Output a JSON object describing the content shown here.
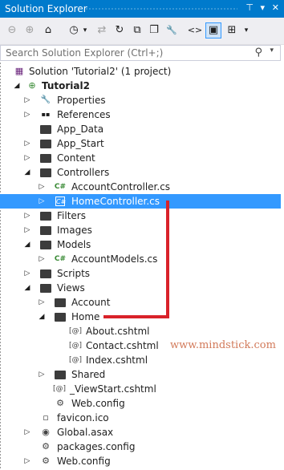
{
  "titlebar": {
    "title": "Solution Explorer",
    "pin_glyph": "⊤",
    "close_glyph": "✕"
  },
  "toolbar": {
    "buttons": [
      {
        "icon": "back-icon",
        "glyph": "⊖"
      },
      {
        "icon": "forward-icon",
        "glyph": "⊕"
      },
      {
        "icon": "home-icon",
        "glyph": "⌂"
      },
      {
        "icon": "history-icon",
        "glyph": "◷"
      },
      {
        "icon": "sync-icon",
        "glyph": "⇄"
      },
      {
        "icon": "refresh-icon",
        "glyph": "↻"
      },
      {
        "icon": "collapse-all-icon",
        "glyph": "⧉"
      },
      {
        "icon": "show-all-files-icon",
        "glyph": "❐"
      },
      {
        "icon": "properties-icon",
        "glyph": "🔧"
      },
      {
        "icon": "view-code-icon",
        "glyph": "<>"
      },
      {
        "icon": "preview-icon",
        "glyph": "▣"
      },
      {
        "icon": "class-view-icon",
        "glyph": "⊞"
      },
      {
        "icon": "dropdown-icon",
        "glyph": "▾"
      }
    ]
  },
  "search": {
    "placeholder": "Search Solution Explorer (Ctrl+;)",
    "icon_glyph": "⚲",
    "dropdown_glyph": "▾"
  },
  "tree": {
    "items": [
      {
        "label": "Solution 'Tutorial2' (1 project)",
        "icon": "solution-icon",
        "glyph": "▦",
        "arrow": ""
      },
      {
        "label": "Tutorial2",
        "icon": "project-icon",
        "glyph": "⊕",
        "arrow": "◢",
        "bold": true
      },
      {
        "label": "Properties",
        "icon": "wrench-icon",
        "glyph": "🔧",
        "arrow": "▷"
      },
      {
        "label": "References",
        "icon": "references-icon",
        "glyph": "▪▪",
        "arrow": "▷"
      },
      {
        "label": "App_Data",
        "icon": "folder-icon",
        "glyph": "",
        "arrow": ""
      },
      {
        "label": "App_Start",
        "icon": "folder-icon",
        "glyph": "",
        "arrow": "▷"
      },
      {
        "label": "Content",
        "icon": "folder-icon",
        "glyph": "",
        "arrow": "▷"
      },
      {
        "label": "Controllers",
        "icon": "folder-icon",
        "glyph": "",
        "arrow": "◢"
      },
      {
        "label": "AccountController.cs",
        "icon": "csharp-file-icon",
        "glyph": "C#",
        "arrow": "▷"
      },
      {
        "label": "HomeController.cs",
        "icon": "csharp-file-icon",
        "glyph": "C#",
        "arrow": "▷",
        "selected": true
      },
      {
        "label": "Filters",
        "icon": "folder-icon",
        "glyph": "",
        "arrow": "▷"
      },
      {
        "label": "Images",
        "icon": "folder-icon",
        "glyph": "",
        "arrow": "▷"
      },
      {
        "label": "Models",
        "icon": "folder-icon",
        "glyph": "",
        "arrow": "◢"
      },
      {
        "label": "AccountModels.cs",
        "icon": "csharp-file-icon",
        "glyph": "C#",
        "arrow": "▷"
      },
      {
        "label": "Scripts",
        "icon": "folder-icon",
        "glyph": "",
        "arrow": "▷"
      },
      {
        "label": "Views",
        "icon": "folder-icon",
        "glyph": "",
        "arrow": "◢"
      },
      {
        "label": "Account",
        "icon": "folder-icon",
        "glyph": "",
        "arrow": "▷"
      },
      {
        "label": "Home",
        "icon": "folder-icon",
        "glyph": "",
        "arrow": "◢"
      },
      {
        "label": "About.cshtml",
        "icon": "razor-file-icon",
        "glyph": "[@]",
        "arrow": ""
      },
      {
        "label": "Contact.cshtml",
        "icon": "razor-file-icon",
        "glyph": "[@]",
        "arrow": ""
      },
      {
        "label": "Index.cshtml",
        "icon": "razor-file-icon",
        "glyph": "[@]",
        "arrow": ""
      },
      {
        "label": "Shared",
        "icon": "folder-icon",
        "glyph": "",
        "arrow": "▷"
      },
      {
        "label": "_ViewStart.cshtml",
        "icon": "razor-file-icon",
        "glyph": "[@]",
        "arrow": ""
      },
      {
        "label": "Web.config",
        "icon": "config-file-icon",
        "glyph": "⚙",
        "arrow": ""
      },
      {
        "label": "favicon.ico",
        "icon": "ico-file-icon",
        "glyph": "▫",
        "arrow": ""
      },
      {
        "label": "Global.asax",
        "icon": "asax-file-icon",
        "glyph": "◉",
        "arrow": "▷"
      },
      {
        "label": "packages.config",
        "icon": "config-file-icon",
        "glyph": "⚙",
        "arrow": ""
      },
      {
        "label": "Web.config",
        "icon": "config-file-icon",
        "glyph": "⚙",
        "arrow": "▷"
      }
    ]
  },
  "watermark": "www.mindstick.com",
  "colors": {
    "accent": "#007acc",
    "selection": "#3399ff",
    "annotation": "#d9222a"
  }
}
